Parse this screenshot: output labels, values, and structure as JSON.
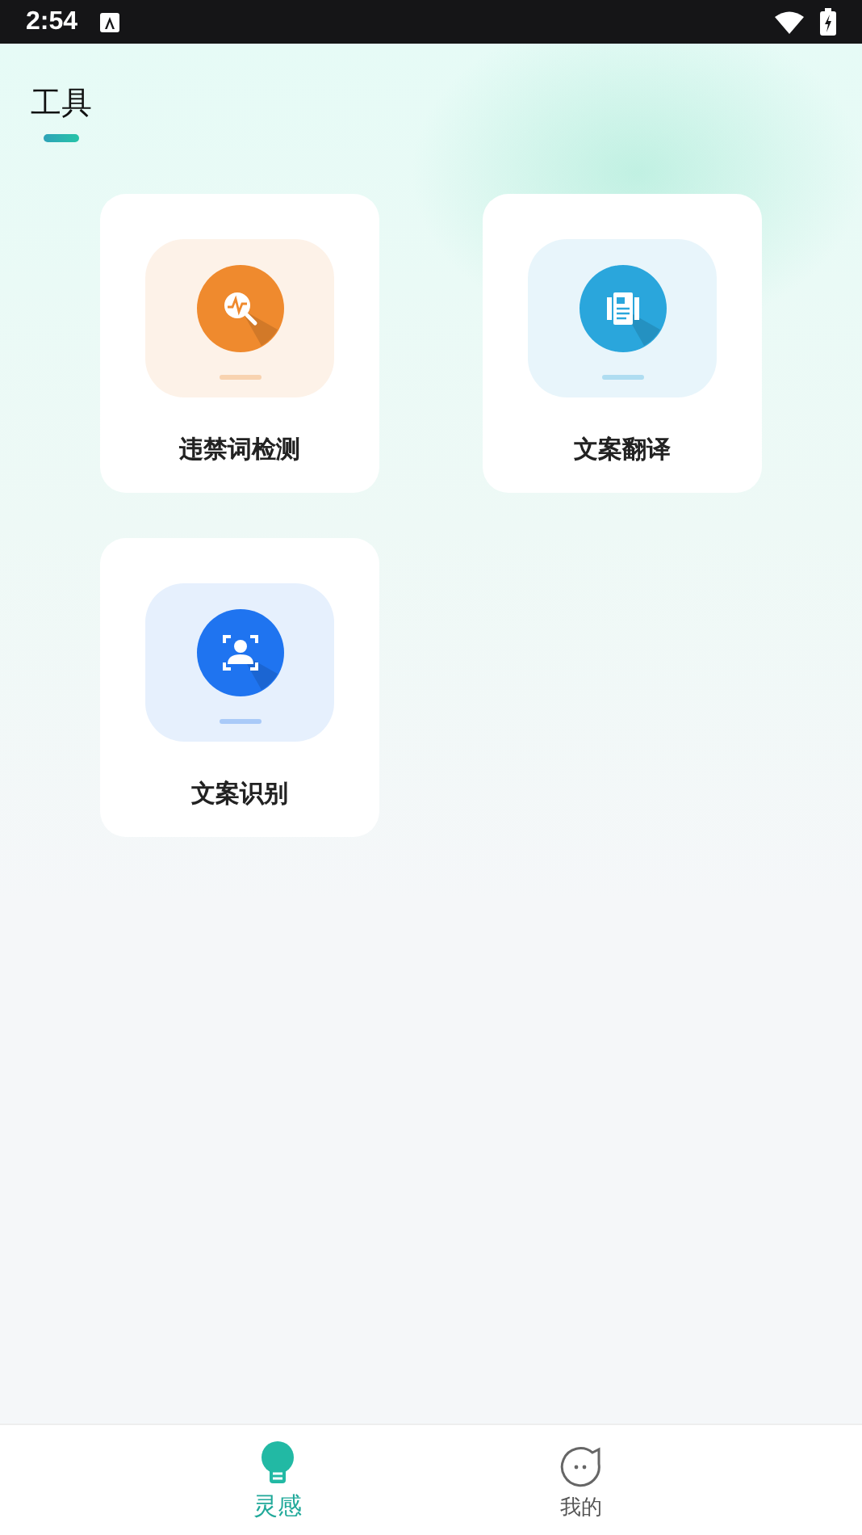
{
  "status_bar": {
    "time": "2:54"
  },
  "header": {
    "title": "工具"
  },
  "tools": [
    {
      "kind": "scan",
      "label": "违禁词检测",
      "color": "#ef8a2e"
    },
    {
      "kind": "translate",
      "label": "文案翻译",
      "color": "#2aa6dc"
    },
    {
      "kind": "ocr",
      "label": "文案识别",
      "color": "#1f74f0"
    }
  ],
  "tab_bar": [
    {
      "kind": "bulb",
      "label": "灵感",
      "selected": true
    },
    {
      "kind": "face",
      "label": "我的",
      "selected": false
    }
  ]
}
